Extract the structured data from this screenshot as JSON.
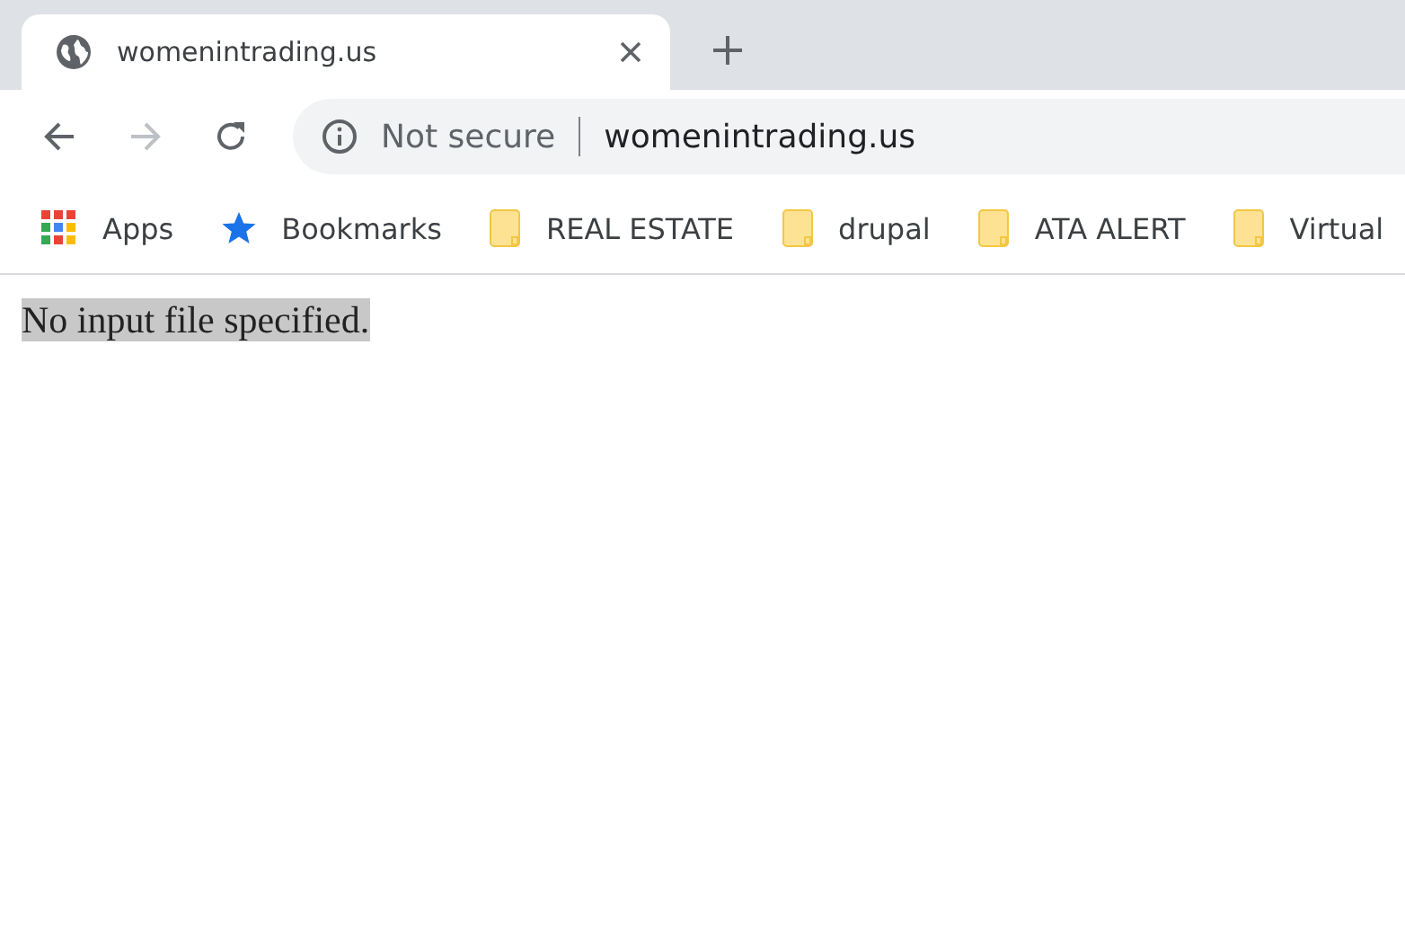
{
  "tabs": [
    {
      "title": "womenintrading.us",
      "selected": true
    }
  ],
  "toolbar": {
    "forward_disabled": true,
    "security": "Not secure",
    "url": "womenintrading.us"
  },
  "bookmarks": [
    {
      "kind": "apps",
      "label": "Apps"
    },
    {
      "kind": "star",
      "label": "Bookmarks"
    },
    {
      "kind": "folder",
      "label": "REAL ESTATE"
    },
    {
      "kind": "folder",
      "label": "drupal"
    },
    {
      "kind": "folder",
      "label": "ATA ALERT"
    },
    {
      "kind": "folder",
      "label": "Virtual"
    }
  ],
  "page": {
    "message": "No input file specified.",
    "highlighted": true
  }
}
